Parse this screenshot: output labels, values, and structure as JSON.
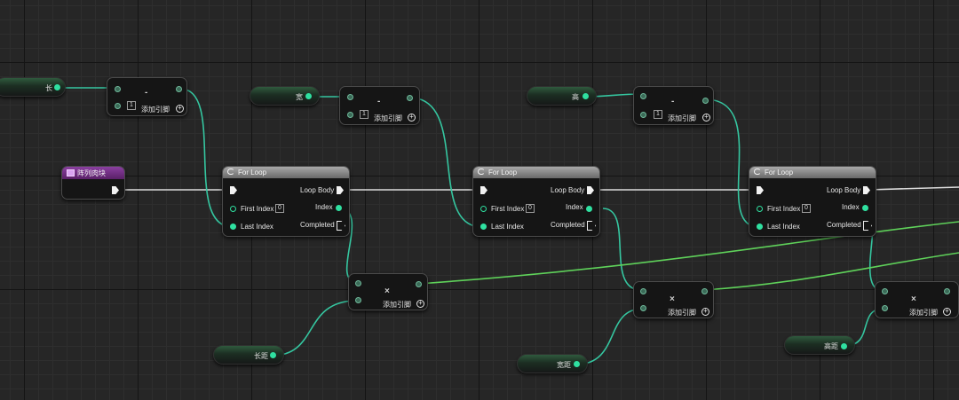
{
  "colors": {
    "float_pin": "#2fe0a0",
    "float_wire": "#35c6a0",
    "int_wire": "#5fd25a",
    "exec_wire": "#e8e8e8",
    "loop_header": "#9a9a9a",
    "event_header": "#7b3290"
  },
  "event": {
    "title": "阵列肉块"
  },
  "vars": {
    "length": "长",
    "width": "宽",
    "height": "高",
    "length_gap": "长距",
    "width_gap": "宽距",
    "height_gap": "高距"
  },
  "subtract": {
    "op": "-",
    "value": "1",
    "add_pin": "添加引脚"
  },
  "multiply": {
    "op": "×",
    "add_pin": "添加引脚"
  },
  "forloop": {
    "title": "For Loop",
    "loop_body": "Loop Body",
    "first_index": "First Index",
    "first_index_value": "0",
    "last_index": "Last Index",
    "index": "Index",
    "completed": "Completed"
  }
}
